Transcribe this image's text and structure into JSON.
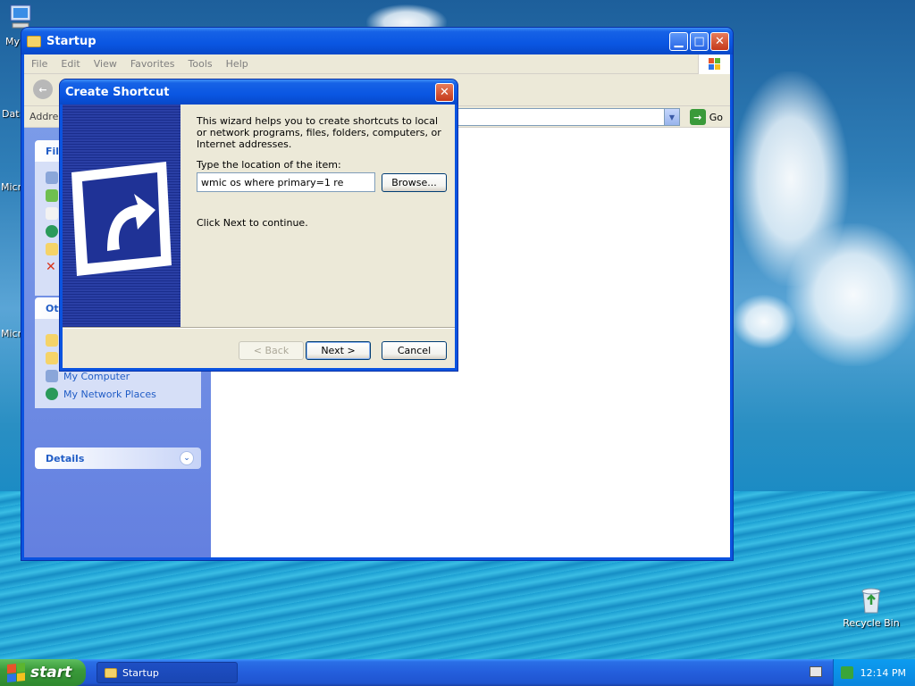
{
  "desktop": {
    "icons": [
      {
        "label": "My"
      },
      {
        "label": "Dat"
      },
      {
        "label": "Micr"
      },
      {
        "label": "Micr"
      },
      {
        "label": "Recycle Bin"
      }
    ]
  },
  "explorer": {
    "title": "Startup",
    "menu": [
      "File",
      "Edit",
      "View",
      "Favorites",
      "Tools",
      "Help"
    ],
    "address_label": "Addres",
    "go_label": "Go",
    "panels": {
      "file_tasks": {
        "heading": "File"
      },
      "other_places": {
        "heading": "Oth",
        "items": [
          "My Computer",
          "My Network Places"
        ]
      },
      "details": {
        "heading": "Details"
      }
    }
  },
  "dialog": {
    "title": "Create Shortcut",
    "intro": "This wizard helps you to create shortcuts to local or network programs, files, folders, computers, or Internet addresses.",
    "location_label": "Type the location of the item:",
    "location_value": "wmic os where primary=1 re",
    "browse_label": "Browse...",
    "hint": "Click Next to continue.",
    "back_label": "< Back",
    "next_label": "Next >",
    "cancel_label": "Cancel"
  },
  "taskbar": {
    "start_label": "start",
    "task_label": "Startup",
    "clock": "12:14 PM"
  },
  "colors": {
    "xp_blue": "#0a53e0",
    "start_green": "#3a9a3a",
    "link_blue": "#215dc6"
  }
}
